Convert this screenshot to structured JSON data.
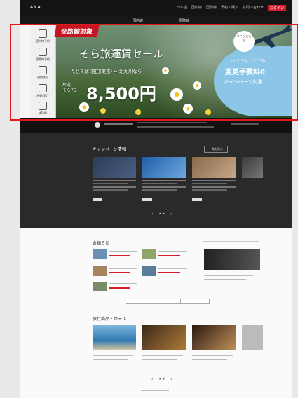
{
  "header": {
    "logo": "ANA",
    "nav": [
      "日本語",
      "国内線",
      "国際線",
      "予約・購入",
      "お問い合わせ"
    ],
    "login_label": "ログイン"
  },
  "main_nav": {
    "tabs": [
      "国内線",
      "国際線"
    ]
  },
  "side_panel": {
    "items": [
      "国内線予約",
      "国際線予約",
      "運航状況",
      "ANA SKY",
      "MENU"
    ]
  },
  "hero": {
    "badge": "全路線対象",
    "title": "そら旅運賃セール",
    "route": "たとえば 羽田(東京) ⇔ 北九州なら",
    "price_label_1": "片道",
    "price_label_2": "そら75",
    "price": "8,500円",
    "bubble_text": "いつでも どこでも",
    "campaign_line1": "いつでも どこでも",
    "campaign_line2": "変更手数料0",
    "campaign_line3": "キャンペーン対象"
  },
  "campaign_section": {
    "title": "キャンペーン情報",
    "more_label": "一覧を見る"
  },
  "section_news": {
    "title": "お知らせ"
  },
  "section_tour": {
    "title": "旅行商品・ホテル"
  },
  "colors": {
    "accent_red": "#d61f2c",
    "frame_red": "#e41a1a",
    "dark_bg": "#2a2a2a",
    "hero_blue": "#8cc6e6"
  }
}
